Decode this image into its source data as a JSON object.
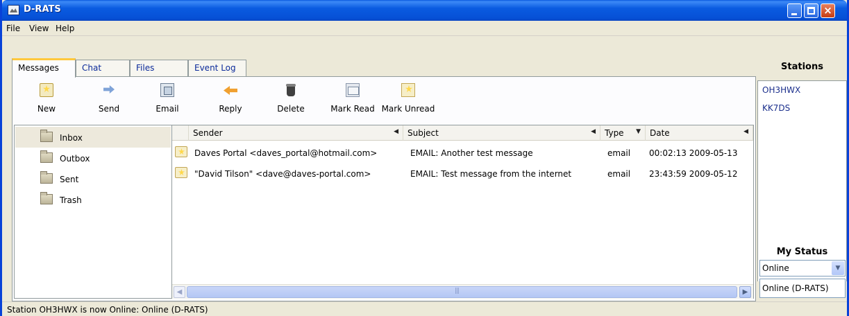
{
  "window": {
    "title": "D-RATS",
    "controls": {
      "minimize": "minimize",
      "maximize": "maximize",
      "close": "×"
    }
  },
  "menu": [
    "File",
    "View",
    "Help"
  ],
  "tabs": [
    {
      "label": "Messages",
      "active": true
    },
    {
      "label": "Chat",
      "active": false
    },
    {
      "label": "Files",
      "active": false
    },
    {
      "label": "Event Log",
      "active": false
    }
  ],
  "toolbar": [
    {
      "label": "New",
      "icon": "new-message-icon"
    },
    {
      "label": "Send",
      "icon": "send-icon"
    },
    {
      "label": "Email",
      "icon": "email-icon"
    },
    {
      "label": "Reply",
      "icon": "reply-icon"
    },
    {
      "label": "Delete",
      "icon": "delete-icon"
    },
    {
      "label": "Mark Read",
      "icon": "mark-read-icon"
    },
    {
      "label": "Mark Unread",
      "icon": "mark-unread-icon"
    }
  ],
  "folders": [
    {
      "label": "Inbox",
      "selected": true
    },
    {
      "label": "Outbox",
      "selected": false
    },
    {
      "label": "Sent",
      "selected": false
    },
    {
      "label": "Trash",
      "selected": false
    }
  ],
  "columns": {
    "sender": "Sender",
    "subject": "Subject",
    "type": "Type",
    "date": "Date"
  },
  "messages": [
    {
      "sender": "Daves Portal <daves_portal@hotmail.com>",
      "subject": "EMAIL: Another test message",
      "type": "email",
      "date": "00:02:13 2009-05-13"
    },
    {
      "sender": "\"David Tilson\" <dave@daves-portal.com>",
      "subject": "EMAIL: Test message from the internet",
      "type": "email",
      "date": "23:43:59 2009-05-12"
    }
  ],
  "sidebar": {
    "stations_title": "Stations",
    "stations": [
      "OH3HWX",
      "KK7DS"
    ],
    "my_status_title": "My Status",
    "status_selected": "Online",
    "status_message": "Online (D-RATS)"
  },
  "statusbar": {
    "text": "Station OH3HWX is now Online: Online (D-RATS)"
  },
  "colors": {
    "titlebar": "#0a5be0",
    "tab_active_accent": "#ffc83c",
    "station_link": "#1b2f8c"
  }
}
